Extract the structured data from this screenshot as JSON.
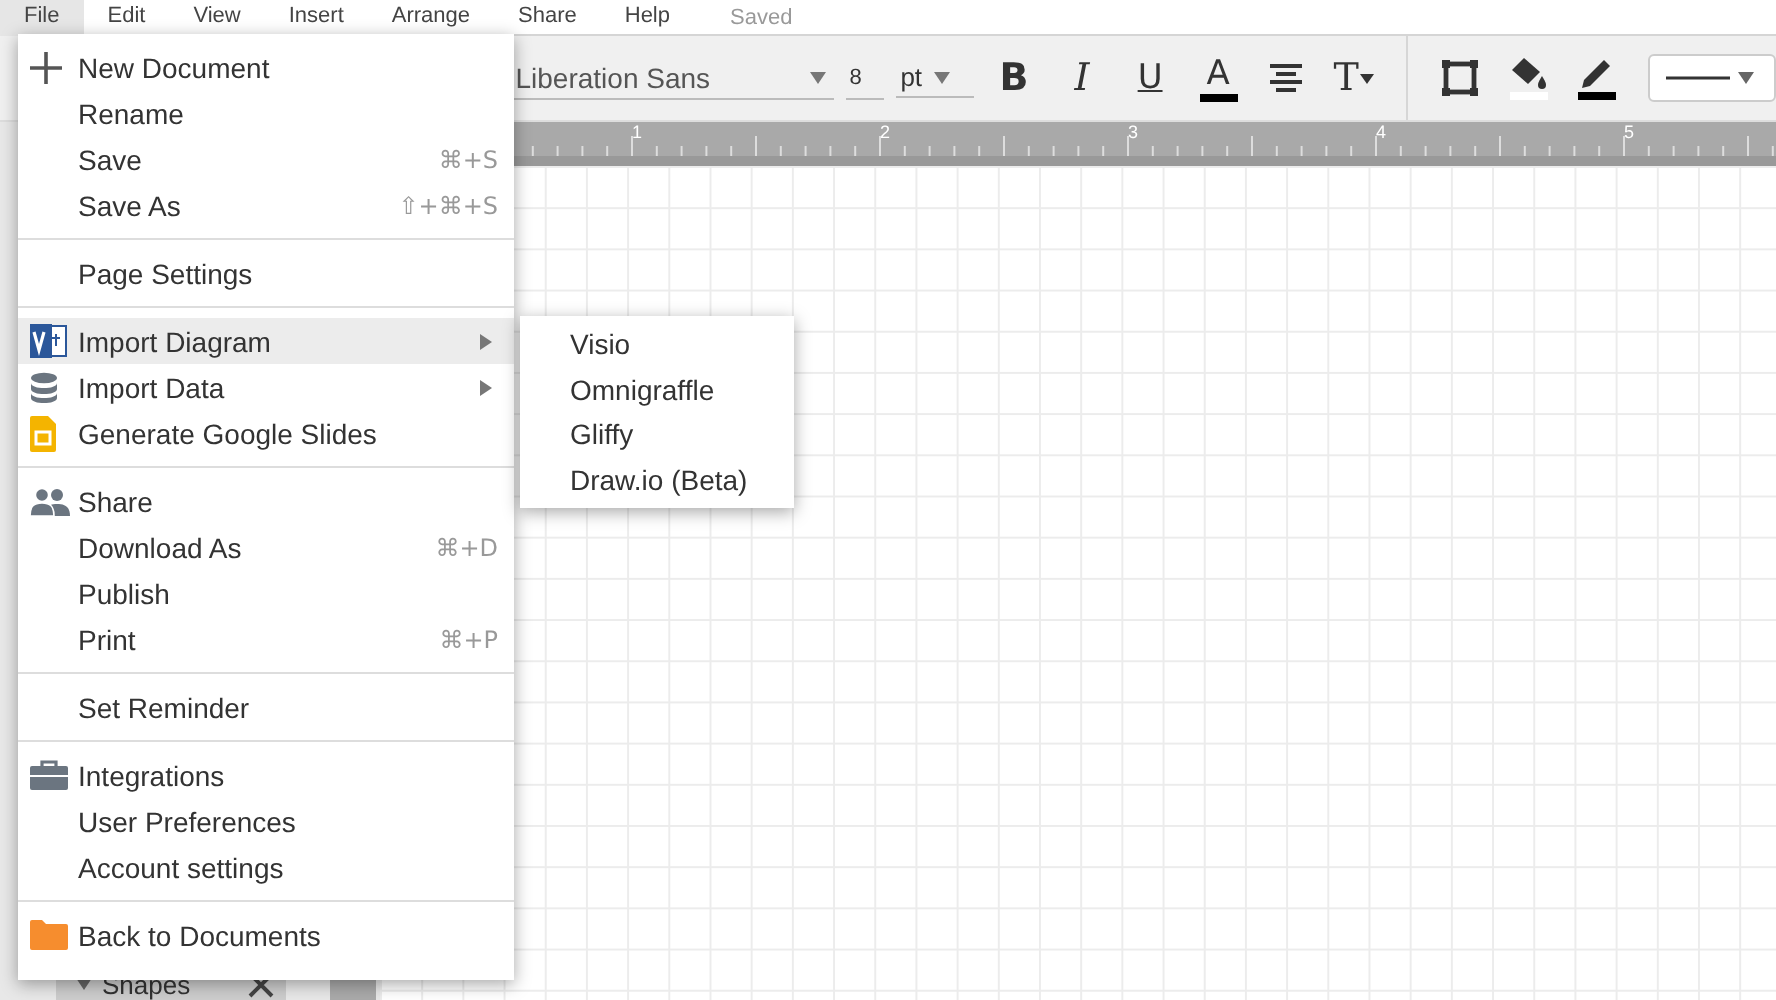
{
  "menubar": {
    "items": [
      {
        "label": "File",
        "selected": true
      },
      {
        "label": "Edit",
        "selected": false
      },
      {
        "label": "View",
        "selected": false
      },
      {
        "label": "Insert",
        "selected": false
      },
      {
        "label": "Arrange",
        "selected": false
      },
      {
        "label": "Share",
        "selected": false
      },
      {
        "label": "Help",
        "selected": false
      }
    ],
    "status": "Saved"
  },
  "toolbar": {
    "font": "Liberation Sans",
    "size": "8",
    "unit": "pt",
    "tools": [
      {
        "kind": "bold",
        "glyph": "B"
      },
      {
        "kind": "italic",
        "glyph": "I"
      },
      {
        "kind": "underline",
        "glyph": "U"
      },
      {
        "kind": "font-color",
        "glyph": "A",
        "color": "#000000"
      },
      {
        "kind": "align"
      },
      {
        "kind": "text-options",
        "glyph": "T"
      },
      {
        "kind": "divider"
      },
      {
        "kind": "border"
      },
      {
        "kind": "fill",
        "color": "#ffffff"
      },
      {
        "kind": "line-color",
        "color": "#000000"
      },
      {
        "kind": "line-style"
      }
    ]
  },
  "ruler": {
    "labels": [
      "1",
      "2",
      "3",
      "4",
      "5"
    ]
  },
  "file_menu": {
    "sections": [
      [
        {
          "label": "New Document",
          "selected": false
        },
        {
          "label": "Rename",
          "selected": false
        },
        {
          "label": "Save",
          "shortcut": "⌘+S",
          "selected": false
        },
        {
          "label": "Save As",
          "shortcut": "⇧+⌘+S",
          "selected": false
        }
      ],
      [
        {
          "label": "Page Settings",
          "selected": false
        }
      ],
      [
        {
          "label": "Import Diagram",
          "submenu": true,
          "selected": true
        },
        {
          "label": "Import Data",
          "submenu": true,
          "selected": false
        },
        {
          "label": "Generate Google Slides",
          "selected": false
        }
      ],
      [
        {
          "label": "Share",
          "selected": false
        },
        {
          "label": "Download As",
          "shortcut": "⌘+D",
          "selected": false
        },
        {
          "label": "Publish",
          "selected": false
        },
        {
          "label": "Print",
          "shortcut": "⌘+P",
          "selected": false
        }
      ],
      [
        {
          "label": "Set Reminder",
          "selected": false
        }
      ],
      [
        {
          "label": "Integrations",
          "selected": false
        },
        {
          "label": "User Preferences",
          "selected": false
        },
        {
          "label": "Account settings",
          "selected": false
        }
      ],
      [
        {
          "label": "Back to Documents",
          "selected": false
        }
      ]
    ]
  },
  "submenu": {
    "items": [
      "Visio",
      "Omnigraffle",
      "Gliffy",
      "Draw.io (Beta)"
    ]
  },
  "sidebar": {
    "panel": "Shapes",
    "expanded": true
  }
}
